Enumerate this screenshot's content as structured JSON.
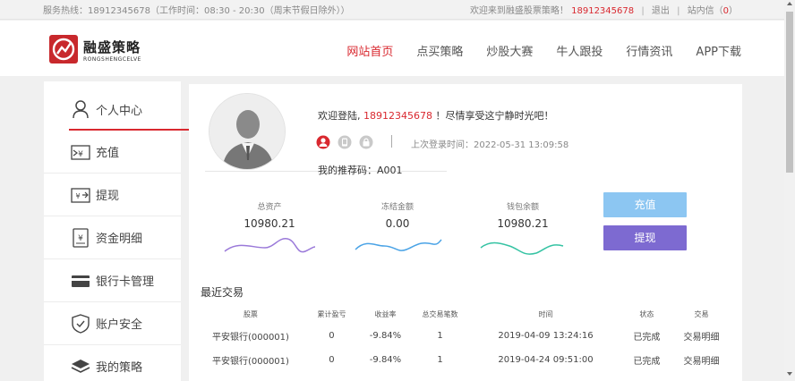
{
  "topbar": {
    "hotline": "服务热线：18912345678（工作时间：08:30 - 20:30（周末节假日除外））",
    "welcome": "欢迎来到融盛股票策略！",
    "phone": "18912345678",
    "logout": "退出",
    "messages_prefix": "站内信（",
    "messages_count": "0",
    "messages_suffix": "）"
  },
  "brand": {
    "name": "融盛策略",
    "sub": "RONGSHENGCELVE",
    "color": "#c8282c"
  },
  "nav": [
    "网站首页",
    "点买策略",
    "炒股大赛",
    "牛人跟投",
    "行情资讯",
    "APP下载"
  ],
  "sidebar": {
    "items": [
      {
        "label": "个人中心",
        "icon": "user-icon"
      },
      {
        "label": "充值",
        "icon": "recharge-icon"
      },
      {
        "label": "提现",
        "icon": "withdraw-icon"
      },
      {
        "label": "资金明细",
        "icon": "fund-detail-icon"
      },
      {
        "label": "银行卡管理",
        "icon": "bank-card-icon"
      },
      {
        "label": "账户安全",
        "icon": "shield-icon"
      },
      {
        "label": "我的策略",
        "icon": "layers-icon"
      }
    ]
  },
  "profile": {
    "welcome_prefix": "欢迎登陆,",
    "phone": "18912345678",
    "welcome_suffix": "！尽情享受这宁静时光吧！",
    "last_login": "上次登录时间：2022-05-31 13:09:58",
    "referral": "我的推荐码：A001"
  },
  "stats": [
    {
      "label": "总资产",
      "value": "10980.21",
      "color": "#9a79d9"
    },
    {
      "label": "冻结金额",
      "value": "0.00",
      "color": "#4aa3e6"
    },
    {
      "label": "钱包余额",
      "value": "10980.21",
      "color": "#35c3a3"
    }
  ],
  "buttons": {
    "recharge": "充值",
    "withdraw": "提现"
  },
  "recent": {
    "title": "最近交易",
    "headers": [
      "股票",
      "累计盈亏",
      "收益率",
      "总交易笔数",
      "时间",
      "状态",
      "交易"
    ],
    "rows": [
      [
        "平安银行(000001)",
        "0",
        "-9.84%",
        "1",
        "2019-04-09 13:24:16",
        "已完成",
        "交易明细"
      ],
      [
        "平安银行(000001)",
        "0",
        "-9.84%",
        "1",
        "2019-04-24 09:51:00",
        "已完成",
        "交易明细"
      ]
    ]
  }
}
